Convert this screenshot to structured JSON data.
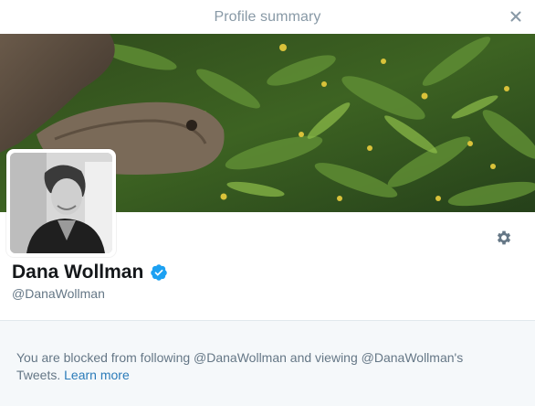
{
  "dialog": {
    "title": "Profile summary"
  },
  "profile": {
    "name": "Dana Wollman",
    "handle": "@DanaWollman",
    "verified": true
  },
  "blocked": {
    "message": "You are blocked from following @DanaWollman and viewing @DanaWollman's Tweets.",
    "link_label": "Learn more"
  },
  "icons": {
    "close": "close-icon",
    "gear": "gear-icon",
    "verified": "verified-badge-icon"
  },
  "colors": {
    "title": "#8899a6",
    "name": "#14171a",
    "handle": "#657786",
    "link": "#2b7bb9",
    "verified": "#1da1f2",
    "footer_bg": "#f5f8fa"
  }
}
